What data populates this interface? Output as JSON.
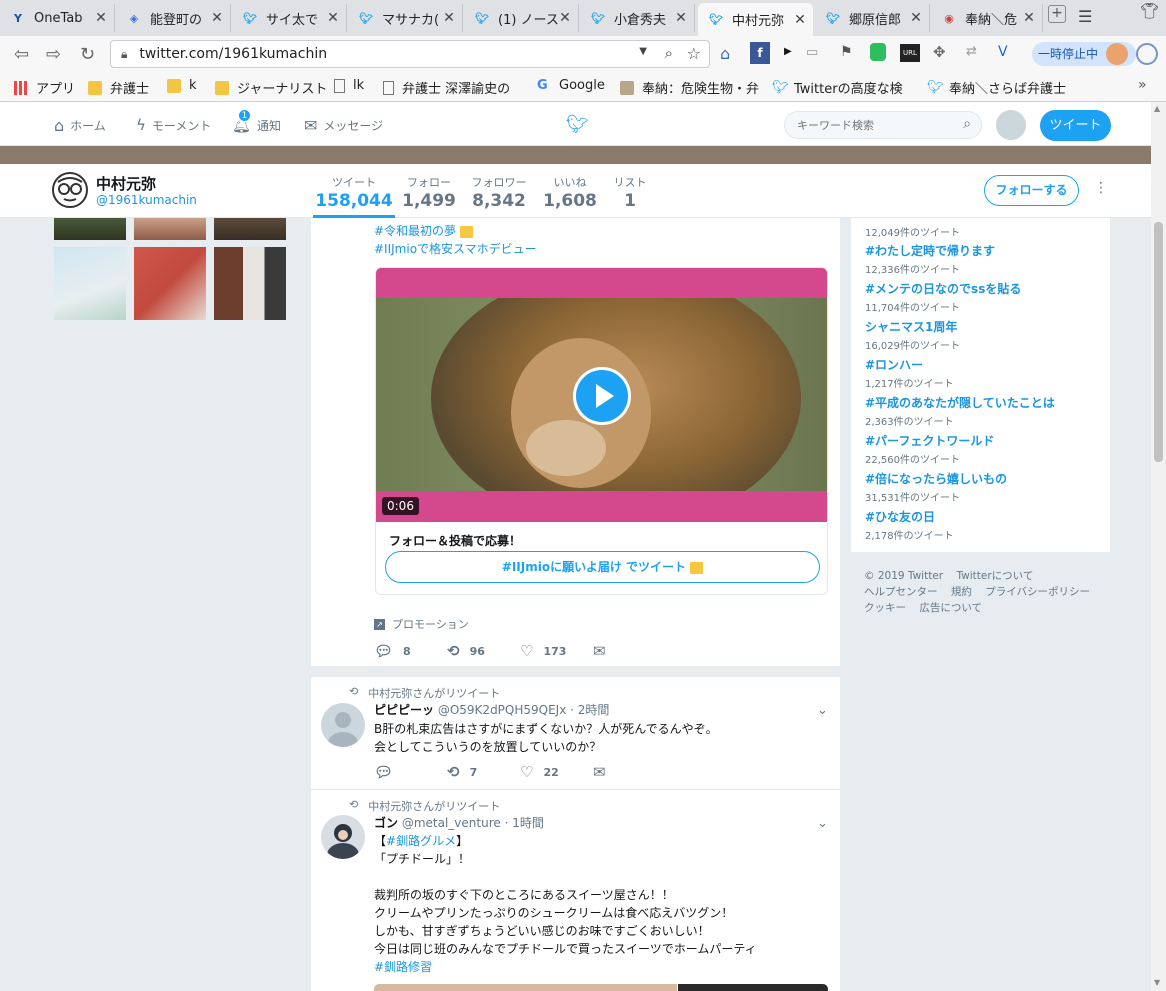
{
  "tabs": [
    {
      "title": "OneTab",
      "icon": "onetab-icon"
    },
    {
      "title": "能登町の",
      "icon": "cube-icon"
    },
    {
      "title": "サイ太で",
      "icon": "twitter-icon"
    },
    {
      "title": "マサナカ(",
      "icon": "twitter-icon"
    },
    {
      "title": "(1) ノース",
      "icon": "twitter-icon"
    },
    {
      "title": "小倉秀夫",
      "icon": "twitter-icon"
    },
    {
      "title": "中村元弥",
      "icon": "twitter-icon",
      "active": true
    },
    {
      "title": "郷原信郎",
      "icon": "twitter-icon"
    },
    {
      "title": "奉納＼危",
      "icon": "hono-icon"
    }
  ],
  "browser": {
    "url": "twitter.com/1961kumachin",
    "pause_label": "一時停止中"
  },
  "bookmarks": [
    {
      "label": "アプリ",
      "icon": "apps-grid-icon"
    },
    {
      "label": "弁護士",
      "icon": "folder-icon"
    },
    {
      "label": "k",
      "icon": "folder-icon"
    },
    {
      "label": "ジャーナリスト",
      "icon": "folder-icon"
    },
    {
      "label": "lk",
      "icon": "page-icon"
    },
    {
      "label": "弁護士 深澤諭史の",
      "icon": "page-icon"
    },
    {
      "label": "Google",
      "icon": "google-icon"
    },
    {
      "label": "奉納：危険生物・弁",
      "icon": "hono-icon"
    },
    {
      "label": "Twitterの高度な検",
      "icon": "twitter-icon"
    },
    {
      "label": "奉納＼さらば弁護士",
      "icon": "twitter-icon"
    }
  ],
  "twnav": {
    "home": "ホーム",
    "moments": "モーメント",
    "notifications": "通知",
    "notif_count": "1",
    "messages": "メッセージ",
    "search_placeholder": "キーワード検索",
    "tweet_button": "ツイート"
  },
  "profile": {
    "name": "中村元弥",
    "handle": "@1961kumachin",
    "stats": [
      {
        "label": "ツイート",
        "value": "158,044",
        "active": true
      },
      {
        "label": "フォロー",
        "value": "1,499"
      },
      {
        "label": "フォロワー",
        "value": "8,342"
      },
      {
        "label": "いいね",
        "value": "1,608"
      },
      {
        "label": "リスト",
        "value": "1"
      }
    ],
    "follow_button": "フォローする"
  },
  "promo_tweet": {
    "hashtag1": "#令和最初の夢",
    "hashtag2": "#IIJmioで格安スマホデビュー",
    "video_duration": "0:06",
    "card_title": "フォロー＆投稿で応募！",
    "card_button": "#IIJmioに願いよ届け でツイート",
    "promoted_label": "プロモーション",
    "replies": "8",
    "retweets": "96",
    "likes": "173"
  },
  "tweet2": {
    "retweeted_by": "中村元弥さんがリツイート",
    "name": "ピピピーッ",
    "handle": "@O59K2dPQH59QEJx",
    "time": "· 2時間",
    "line1": "B肝の札束広告はさすがにまずくないか？人が死んでるんやぞ。",
    "line2": "会としてこういうのを放置していいのか？",
    "replies": "",
    "retweets": "7",
    "likes": "22"
  },
  "tweet3": {
    "retweeted_by": "中村元弥さんがリツイート",
    "name": "ゴン",
    "handle": "@metal_venture",
    "time": "· 1時間",
    "line1_pre": "【",
    "line1_tag": "#釧路グルメ",
    "line1_post": "】",
    "line2": "「プチドール」！",
    "line3": "裁判所の坂のすぐ下のところにあるスイーツ屋さん！！",
    "line4": "クリームやプリンたっぷりのシュークリームは食べ応えバツグン！",
    "line5": "しかも、甘すぎずちょうどいい感じのお味ですごくおいしい！",
    "line6": "今日は同じ班のみんなでプチドールで買ったスイーツでホームパーティ",
    "line7": "#釧路修習"
  },
  "trends": [
    {
      "name": "",
      "count": "12,049件のツイート"
    },
    {
      "name": "#わたし定時で帰ります",
      "count": "12,336件のツイート"
    },
    {
      "name": "#メンテの日なのでssを貼る",
      "count": "11,704件のツイート"
    },
    {
      "name": "シャニマス1周年",
      "count": "16,029件のツイート"
    },
    {
      "name": "#ロンハー",
      "count": "1,217件のツイート"
    },
    {
      "name": "#平成のあなたが隠していたことは",
      "count": "2,363件のツイート"
    },
    {
      "name": "#パーフェクトワールド",
      "count": "22,560件のツイート"
    },
    {
      "name": "#倍になったら嬉しいもの",
      "count": "31,531件のツイート"
    },
    {
      "name": "#ひな友の日",
      "count": "2,178件のツイート"
    }
  ],
  "footer": {
    "line1a": "© 2019 Twitter",
    "line1b": "Twitterについて",
    "line2a": "ヘルプセンター",
    "line2b": "規約",
    "line2c": "プライバシーポリシー",
    "line3a": "クッキー",
    "line3b": "広告について"
  },
  "colors": {
    "twitter_blue": "#1da1f2",
    "promo_pink": "#d4488e",
    "link": "#1b95e0"
  }
}
